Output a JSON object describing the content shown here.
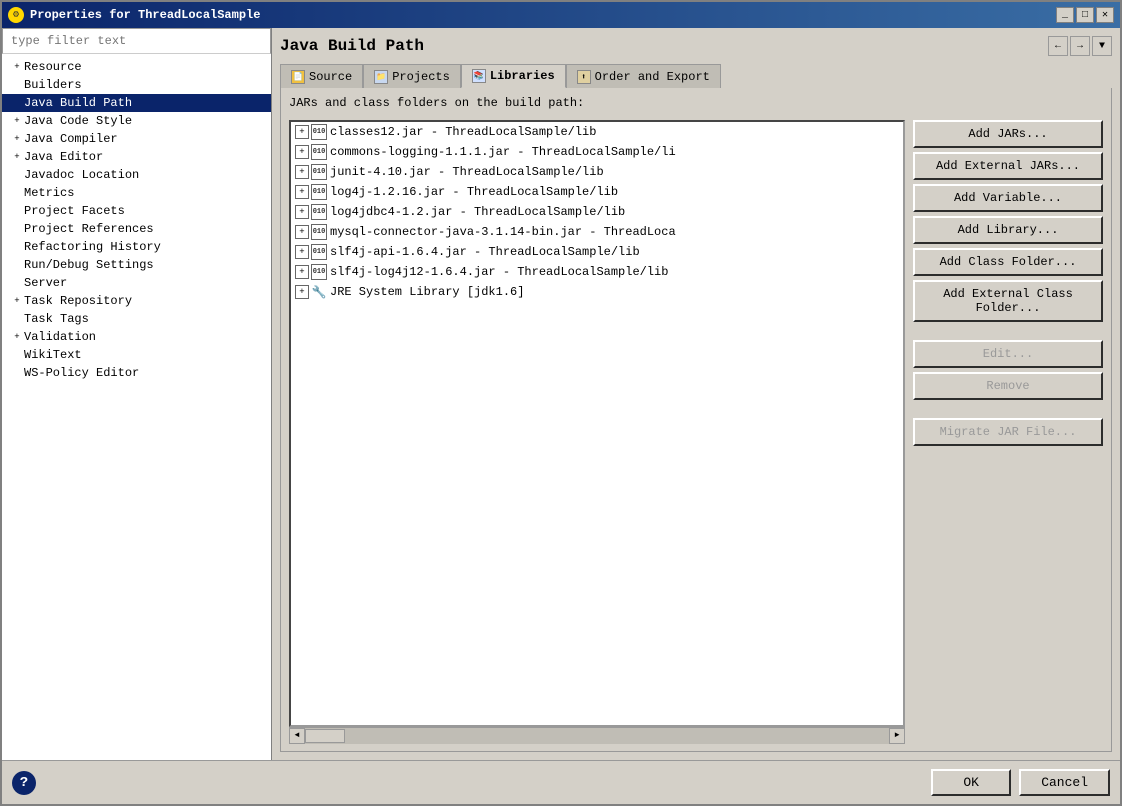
{
  "window": {
    "title": "Properties for ThreadLocalSample",
    "icon": "⚙"
  },
  "titlebar_controls": [
    "_",
    "□",
    "✕"
  ],
  "left_panel": {
    "filter_placeholder": "type filter text",
    "tree_items": [
      {
        "id": "resource",
        "label": "Resource",
        "indent": 0,
        "expandable": true,
        "expanded": false
      },
      {
        "id": "builders",
        "label": "Builders",
        "indent": 1,
        "expandable": false
      },
      {
        "id": "java-build-path",
        "label": "Java Build Path",
        "indent": 1,
        "expandable": false,
        "selected": true
      },
      {
        "id": "java-code-style",
        "label": "Java Code Style",
        "indent": 0,
        "expandable": true,
        "expanded": false
      },
      {
        "id": "java-compiler",
        "label": "Java Compiler",
        "indent": 0,
        "expandable": true,
        "expanded": false
      },
      {
        "id": "java-editor",
        "label": "Java Editor",
        "indent": 0,
        "expandable": true,
        "expanded": false
      },
      {
        "id": "javadoc-location",
        "label": "Javadoc Location",
        "indent": 1,
        "expandable": false
      },
      {
        "id": "metrics",
        "label": "Metrics",
        "indent": 1,
        "expandable": false
      },
      {
        "id": "project-facets",
        "label": "Project Facets",
        "indent": 1,
        "expandable": false
      },
      {
        "id": "project-references",
        "label": "Project References",
        "indent": 1,
        "expandable": false
      },
      {
        "id": "refactoring-history",
        "label": "Refactoring History",
        "indent": 1,
        "expandable": false
      },
      {
        "id": "run-debug-settings",
        "label": "Run/Debug Settings",
        "indent": 1,
        "expandable": false
      },
      {
        "id": "server",
        "label": "Server",
        "indent": 1,
        "expandable": false
      },
      {
        "id": "task-repository",
        "label": "Task Repository",
        "indent": 0,
        "expandable": true,
        "expanded": false
      },
      {
        "id": "task-tags",
        "label": "Task Tags",
        "indent": 1,
        "expandable": false
      },
      {
        "id": "validation",
        "label": "Validation",
        "indent": 0,
        "expandable": true,
        "expanded": false
      },
      {
        "id": "wikitext",
        "label": "WikiText",
        "indent": 1,
        "expandable": false
      },
      {
        "id": "ws-policy-editor",
        "label": "WS-Policy Editor",
        "indent": 1,
        "expandable": false
      }
    ]
  },
  "right_panel": {
    "title": "Java Build Path",
    "nav_buttons": [
      "←",
      "→",
      "▼"
    ],
    "tabs": [
      {
        "id": "source",
        "label": "Source",
        "active": false
      },
      {
        "id": "projects",
        "label": "Projects",
        "active": false
      },
      {
        "id": "libraries",
        "label": "Libraries",
        "active": true
      },
      {
        "id": "order-export",
        "label": "Order and Export",
        "active": false
      }
    ],
    "description": "JARs and class folders on the build path:",
    "libraries": [
      {
        "name": "classes12.jar - ThreadLocalSample/lib",
        "type": "jar"
      },
      {
        "name": "commons-logging-1.1.1.jar - ThreadLocalSample/li",
        "type": "jar"
      },
      {
        "name": "junit-4.10.jar - ThreadLocalSample/lib",
        "type": "jar"
      },
      {
        "name": "log4j-1.2.16.jar - ThreadLocalSample/lib",
        "type": "jar"
      },
      {
        "name": "log4jdbc4-1.2.jar - ThreadLocalSample/lib",
        "type": "jar"
      },
      {
        "name": "mysql-connector-java-3.1.14-bin.jar - ThreadLoca",
        "type": "jar"
      },
      {
        "name": "slf4j-api-1.6.4.jar - ThreadLocalSample/lib",
        "type": "jar"
      },
      {
        "name": "slf4j-log4j12-1.6.4.jar - ThreadLocalSample/lib",
        "type": "jar"
      },
      {
        "name": "JRE System Library [jdk1.6]",
        "type": "jre"
      }
    ],
    "buttons": [
      {
        "id": "add-jars",
        "label": "Add JARs...",
        "disabled": false
      },
      {
        "id": "add-external-jars",
        "label": "Add External JARs...",
        "disabled": false
      },
      {
        "id": "add-variable",
        "label": "Add Variable...",
        "disabled": false
      },
      {
        "id": "add-library",
        "label": "Add Library...",
        "disabled": false
      },
      {
        "id": "add-class-folder",
        "label": "Add Class Folder...",
        "disabled": false
      },
      {
        "id": "add-external-class-folder",
        "label": "Add External Class Folder...",
        "disabled": false
      },
      {
        "id": "edit",
        "label": "Edit...",
        "disabled": true
      },
      {
        "id": "remove",
        "label": "Remove",
        "disabled": true
      },
      {
        "id": "migrate-jar",
        "label": "Migrate JAR File...",
        "disabled": true
      }
    ]
  },
  "bottom": {
    "help_label": "?",
    "ok_label": "OK",
    "cancel_label": "Cancel"
  }
}
